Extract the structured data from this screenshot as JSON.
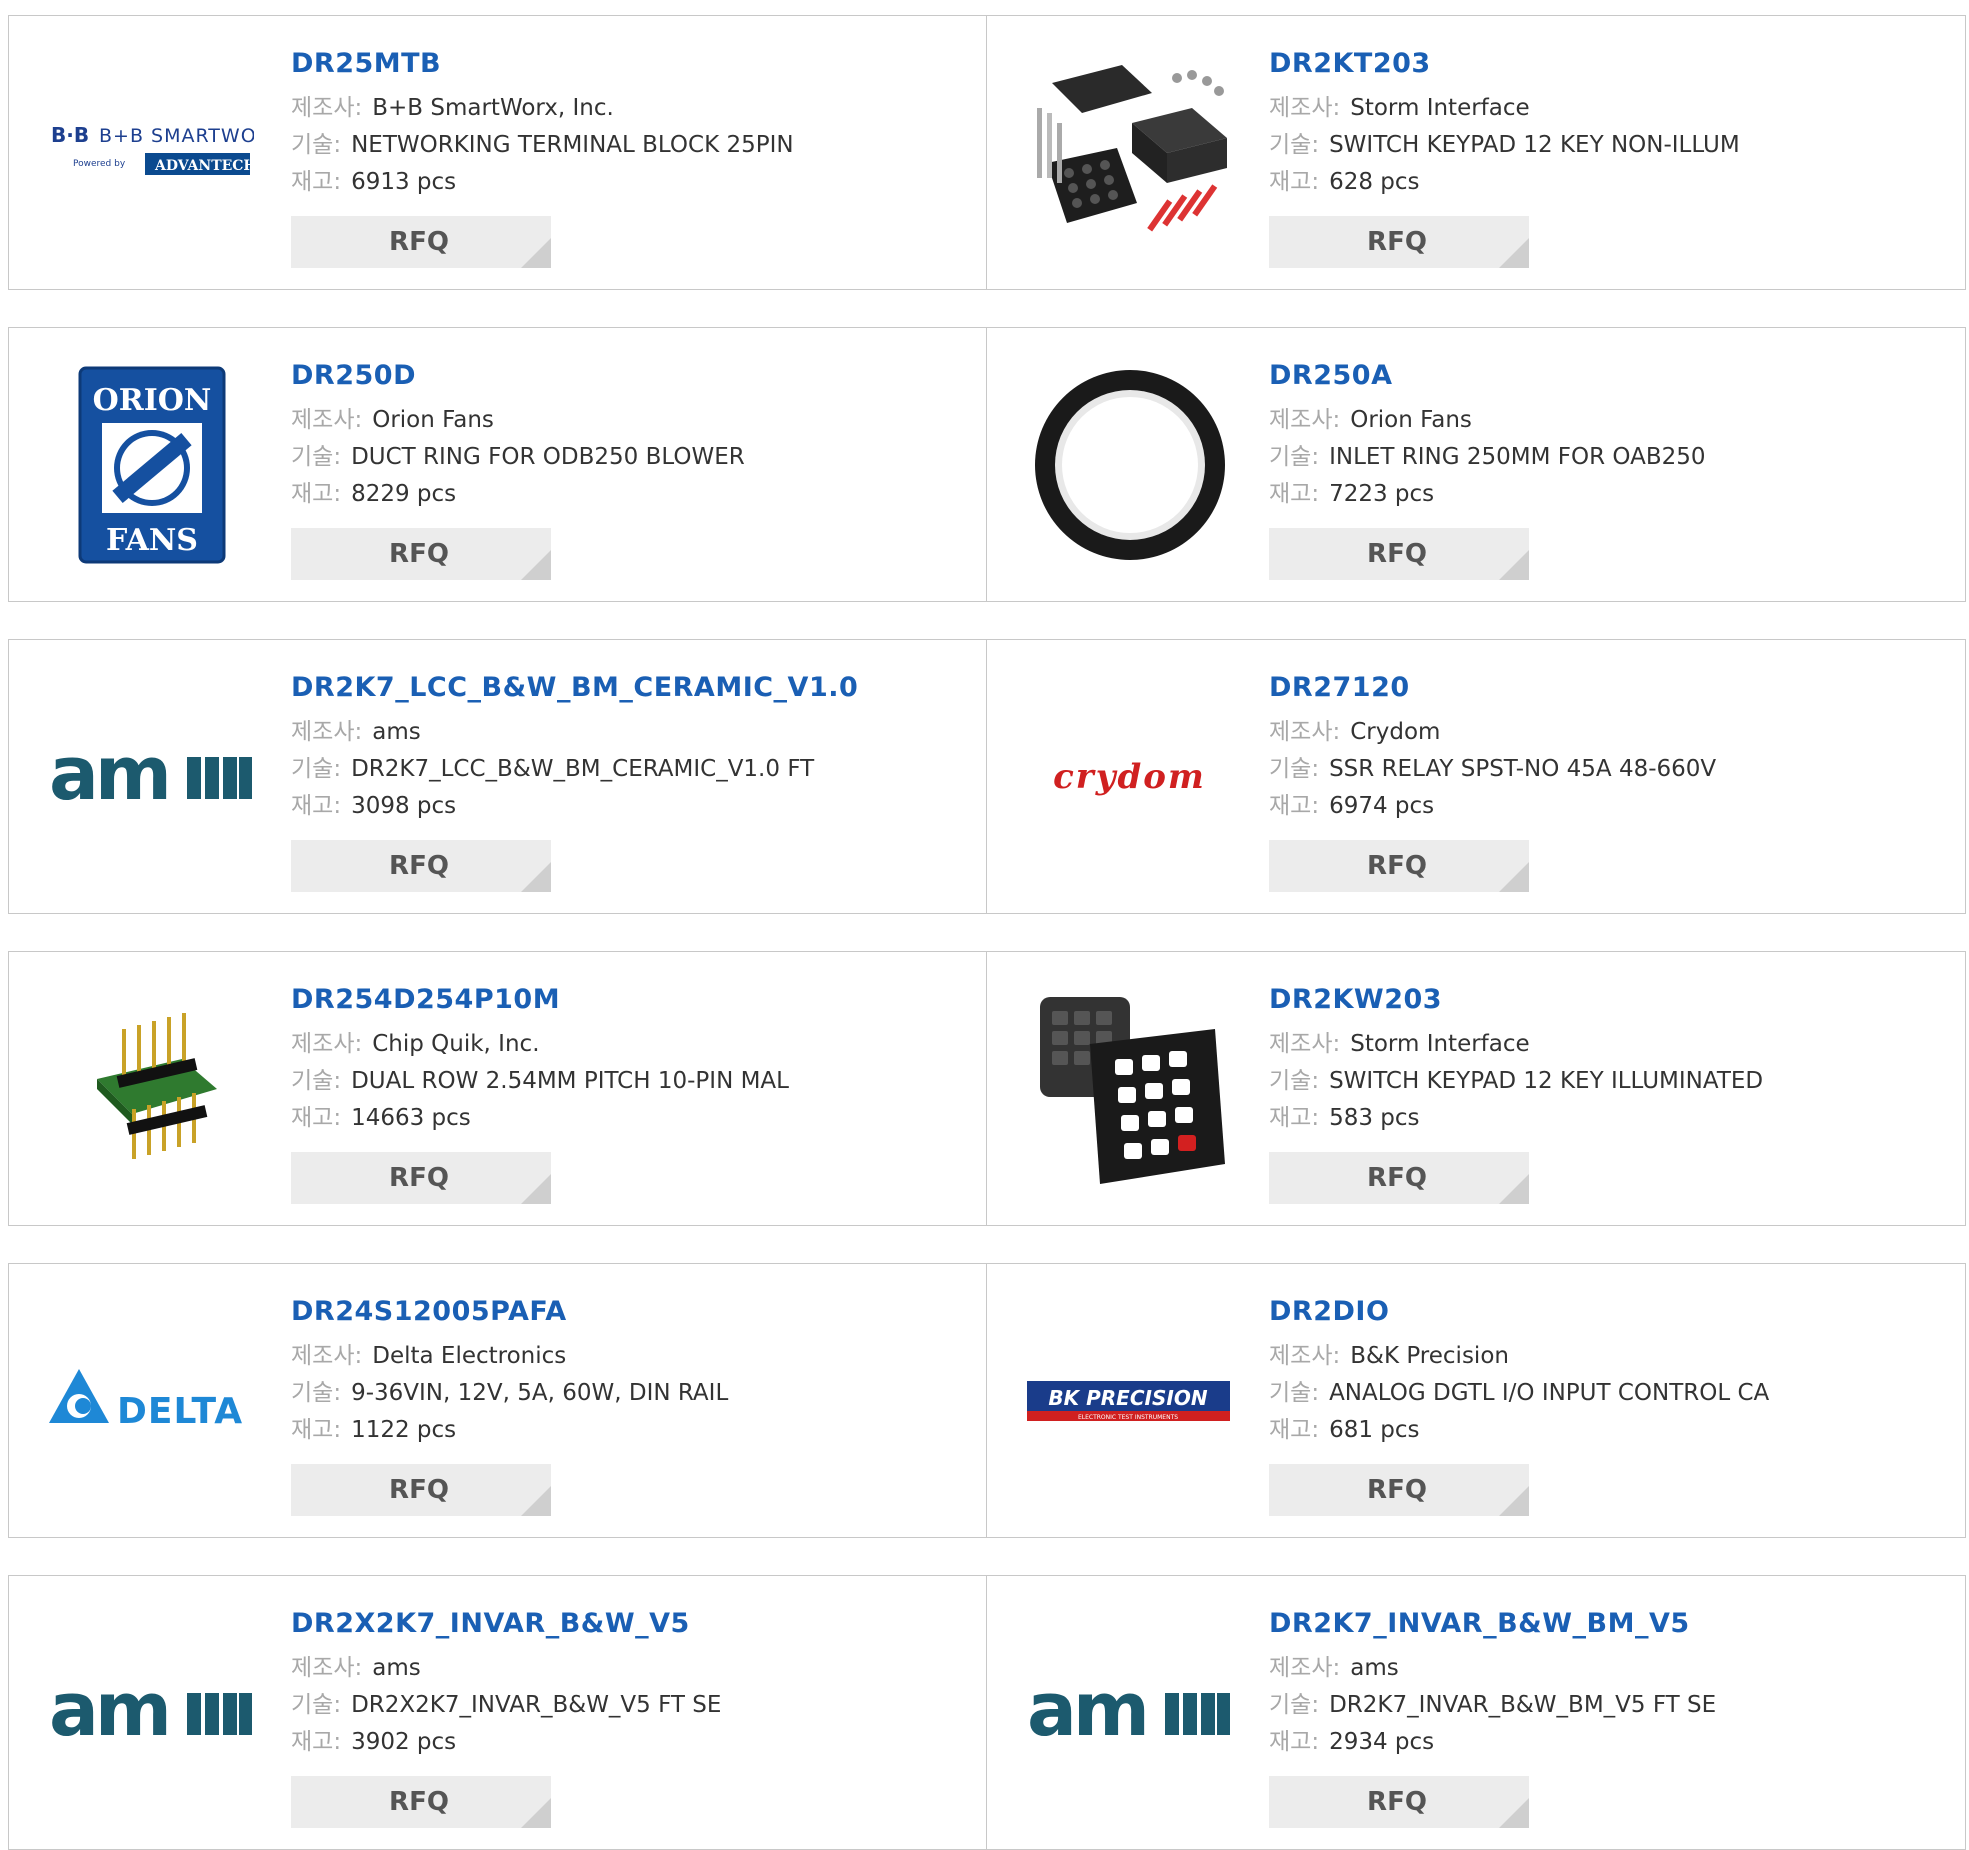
{
  "labels": {
    "manufacturer": "제조사:",
    "description": "기술:",
    "stock": "재고:",
    "rfq": "RFQ"
  },
  "products": [
    {
      "part": "DR25MTB",
      "manufacturer": "B+B SmartWorx, Inc.",
      "description": "NETWORKING TERMINAL BLOCK 25PIN",
      "stock": "6913 pcs",
      "image": "bb-smartworx-advantech-logo"
    },
    {
      "part": "DR2KT203",
      "manufacturer": "Storm Interface",
      "description": "SWITCH KEYPAD 12 KEY NON-ILLUM",
      "stock": "628 pcs",
      "image": "keypad-kit-photo"
    },
    {
      "part": "DR250D",
      "manufacturer": "Orion Fans",
      "description": "DUCT RING FOR ODB250 BLOWER",
      "stock": "8229 pcs",
      "image": "orion-fans-logo"
    },
    {
      "part": "DR250A",
      "manufacturer": "Orion Fans",
      "description": "INLET RING 250MM FOR OAB250",
      "stock": "7223 pcs",
      "image": "inlet-ring-photo"
    },
    {
      "part": "DR2K7_LCC_B&W_BM_CERAMIC_V1.0",
      "manufacturer": "ams",
      "description": "DR2K7_LCC_B&W_BM_CERAMIC_V1.0 FT",
      "stock": "3098 pcs",
      "image": "ams-logo"
    },
    {
      "part": "DR27120",
      "manufacturer": "Crydom",
      "description": "SSR RELAY SPST-NO 45A 48-660V",
      "stock": "6974 pcs",
      "image": "crydom-logo"
    },
    {
      "part": "DR254D254P10M",
      "manufacturer": "Chip Quik, Inc.",
      "description": "DUAL ROW 2.54MM PITCH 10-PIN MAL",
      "stock": "14663 pcs",
      "image": "pin-header-board-photo"
    },
    {
      "part": "DR2KW203",
      "manufacturer": "Storm Interface",
      "description": "SWITCH KEYPAD 12 KEY ILLUMINATED",
      "stock": "583 pcs",
      "image": "illuminated-keypad-photo"
    },
    {
      "part": "DR24S12005PAFA",
      "manufacturer": "Delta Electronics",
      "description": "9-36VIN, 12V, 5A, 60W, DIN RAIL",
      "stock": "1122 pcs",
      "image": "delta-logo"
    },
    {
      "part": "DR2DIO",
      "manufacturer": "B&K Precision",
      "description": "ANALOG DGTL I/O INPUT CONTROL CA",
      "stock": "681 pcs",
      "image": "bk-precision-logo"
    },
    {
      "part": "DR2X2K7_INVAR_B&W_V5",
      "manufacturer": "ams",
      "description": "DR2X2K7_INVAR_B&W_V5 FT SE",
      "stock": "3902 pcs",
      "image": "ams-logo"
    },
    {
      "part": "DR2K7_INVAR_B&W_BM_V5",
      "manufacturer": "ams",
      "description": "DR2K7_INVAR_B&W_BM_V5 FT SE",
      "stock": "2934 pcs",
      "image": "ams-logo"
    }
  ],
  "logos": {
    "bb": {
      "line1": "B+B SMARTWORX",
      "line2": "Powered by",
      "line3": "ADVANTECH"
    },
    "orion": {
      "top": "ORION",
      "bottom": "FANS"
    },
    "ams": "am",
    "crydom": "crydom",
    "delta": "DELTA",
    "bk": {
      "main": "BK PRECISION",
      "sub": "ELECTRONIC TEST INSTRUMENTS"
    }
  },
  "colors": {
    "part_link": "#1a5fb4",
    "label": "#a8a8a8",
    "rfq_bg": "#ececec",
    "border": "#c8c8c8"
  }
}
